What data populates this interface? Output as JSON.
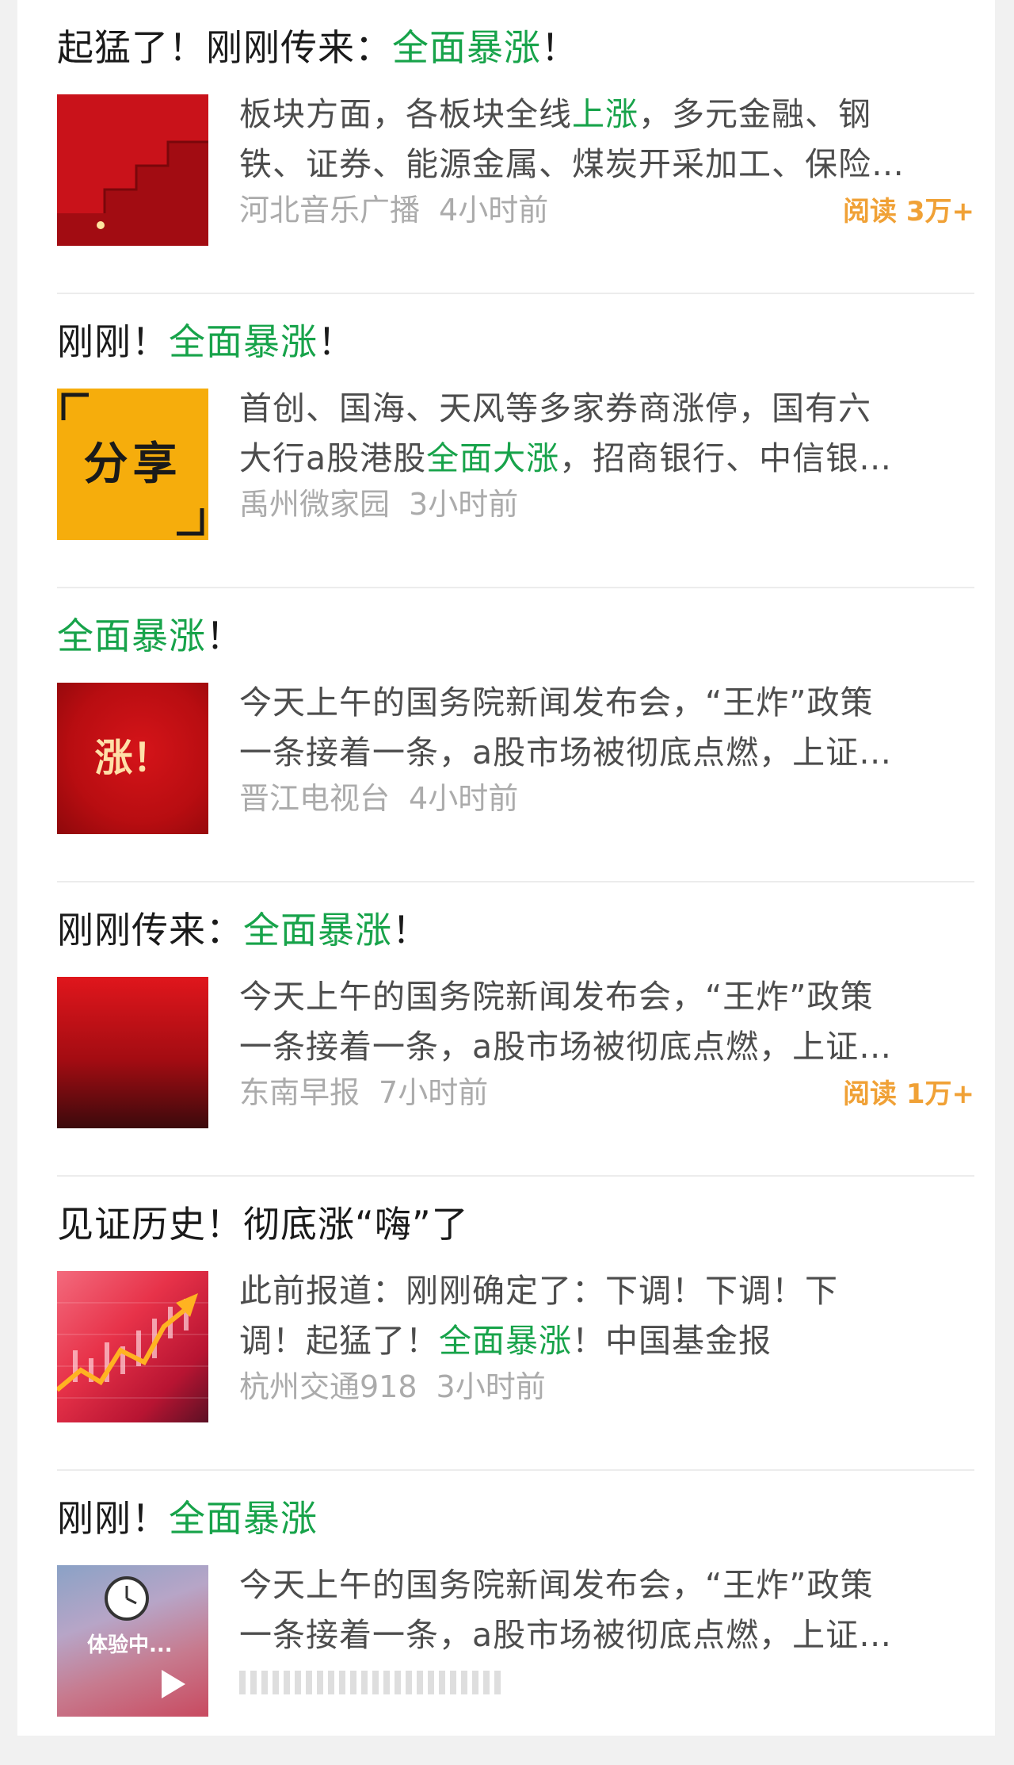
{
  "articles": [
    {
      "title_before": "起猛了！刚刚传来：",
      "title_highlight": "全面暴涨",
      "title_after": "！",
      "summary_line1_before": "板块方面，各板块全线",
      "summary_line1_highlight": "上涨",
      "summary_line1_after": "，多元金融、钢",
      "summary_line2_before": "铁、证券、能源金属、煤炭开采加工、保险…",
      "summary_line2_highlight": "",
      "summary_line2_after": "",
      "source": "河北音乐广播",
      "time": "4小时前",
      "reads": "阅读 3万+",
      "thumb_icon": "red-stairs-image",
      "thumb_text": ""
    },
    {
      "title_before": "刚刚！",
      "title_highlight": "全面暴涨",
      "title_after": "！",
      "summary_line1_before": "首创、国海、天风等多家券商涨停，国有六",
      "summary_line1_highlight": "",
      "summary_line1_after": "",
      "summary_line2_before": "大行a股港股",
      "summary_line2_highlight": "全面大涨",
      "summary_line2_after": "，招商银行、中信银…",
      "source": "禹州微家园",
      "time": "3小时前",
      "reads": "",
      "thumb_icon": "share-image",
      "thumb_text": "分享"
    },
    {
      "title_before": "",
      "title_highlight": "全面暴涨",
      "title_after": "！",
      "summary_line1_before": "今天上午的国务院新闻发布会，“王炸”政策",
      "summary_line1_highlight": "",
      "summary_line1_after": "",
      "summary_line2_before": "一条接着一条，a股市场被彻底点燃，上证…",
      "summary_line2_highlight": "",
      "summary_line2_after": "",
      "source": "晋江电视台",
      "time": "4小时前",
      "reads": "",
      "thumb_icon": "rise-image",
      "thumb_text": "涨！"
    },
    {
      "title_before": "刚刚传来：",
      "title_highlight": "全面暴涨",
      "title_after": "！",
      "summary_line1_before": "今天上午的国务院新闻发布会，“王炸”政策",
      "summary_line1_highlight": "",
      "summary_line1_after": "",
      "summary_line2_before": "一条接着一条，a股市场被彻底点燃，上证…",
      "summary_line2_highlight": "",
      "summary_line2_after": "",
      "source": "东南早报",
      "time": "7小时前",
      "reads": "阅读 1万+",
      "thumb_icon": "red-gradient-image",
      "thumb_text": ""
    },
    {
      "title_before": "见证历史！彻底涨“嗨”了",
      "title_highlight": "",
      "title_after": "",
      "summary_line1_before": "此前报道：刚刚确定了：下调！下调！下",
      "summary_line1_highlight": "",
      "summary_line1_after": "",
      "summary_line2_before": "调！起猛了！",
      "summary_line2_highlight": "全面暴涨",
      "summary_line2_after": "！中国基金报",
      "source": "杭州交通918",
      "time": "3小时前",
      "reads": "",
      "thumb_icon": "stock-chart-image",
      "thumb_text": ""
    },
    {
      "title_before": "刚刚！",
      "title_highlight": "全面暴涨",
      "title_after": "",
      "summary_line1_before": "今天上午的国务院新闻发布会，“王炸”政策",
      "summary_line1_highlight": "",
      "summary_line1_after": "",
      "summary_line2_before": "一条接着一条，a股市场被彻底点燃，上证…",
      "summary_line2_highlight": "",
      "summary_line2_after": "",
      "source": "",
      "time": "",
      "reads": "",
      "thumb_icon": "video-thumbnail",
      "thumb_text": "体验中..."
    }
  ]
}
